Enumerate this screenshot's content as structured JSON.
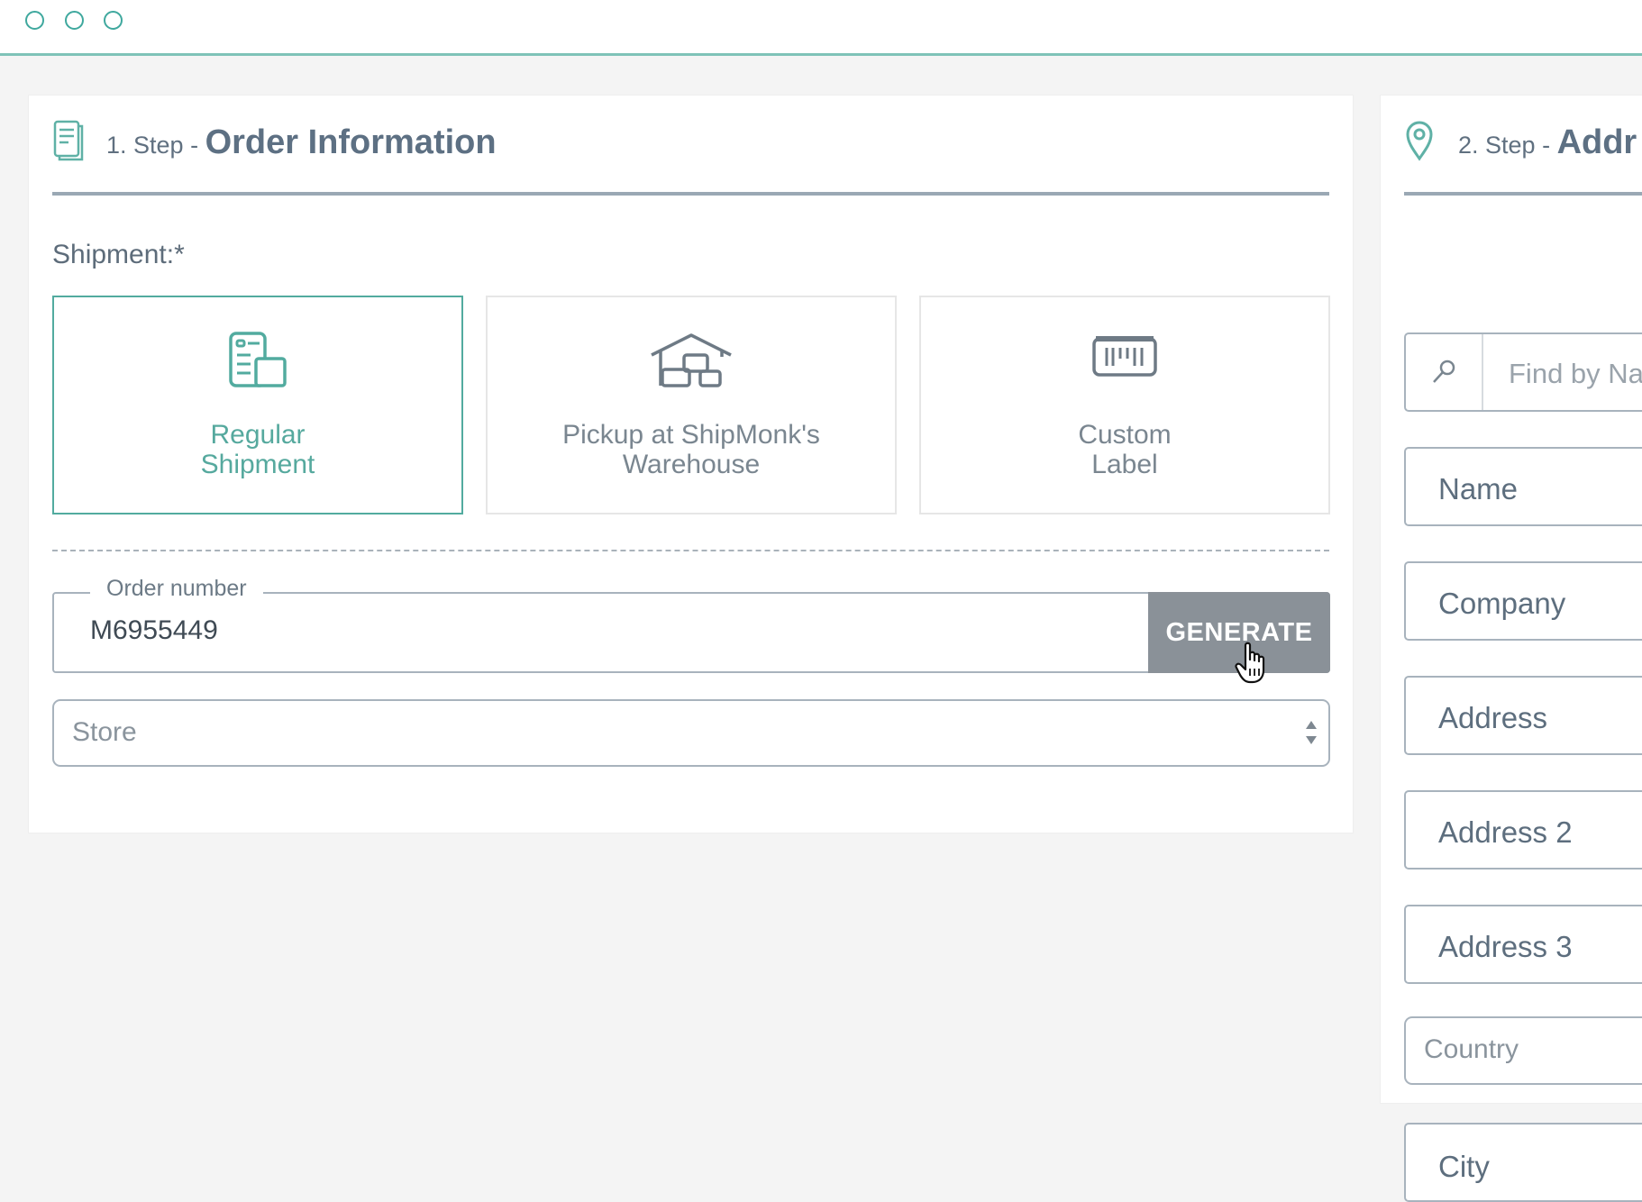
{
  "window": {
    "controls": [
      "close",
      "minimize",
      "maximize"
    ]
  },
  "step1": {
    "step_prefix": "1. Step - ",
    "title": "Order Information",
    "icon": "document-icon",
    "shipment_label": "Shipment:*",
    "options": [
      {
        "label_line1": "Regular",
        "label_line2": "Shipment",
        "icon": "regular-shipment-icon",
        "selected": true
      },
      {
        "label_line1": "Pickup at ShipMonk's",
        "label_line2": "Warehouse",
        "icon": "warehouse-icon",
        "selected": false
      },
      {
        "label_line1": "Custom",
        "label_line2": "Label",
        "icon": "barcode-label-icon",
        "selected": false
      }
    ],
    "order_number": {
      "legend": "Order number",
      "value": "M6955449",
      "generate_label": "GENERATE"
    },
    "store": {
      "placeholder": "Store"
    }
  },
  "step2": {
    "step_prefix": "2. Step - ",
    "title": "Addr",
    "icon": "location-pin-icon",
    "search_placeholder": "Find by Na",
    "fields": [
      "Name",
      "Company",
      "Address",
      "Address 2",
      "Address 3",
      "Country",
      "City"
    ]
  },
  "colors": {
    "accent": "#52ab9f",
    "header_rule": "#9aa8b4",
    "button_gray": "#8a9198"
  }
}
